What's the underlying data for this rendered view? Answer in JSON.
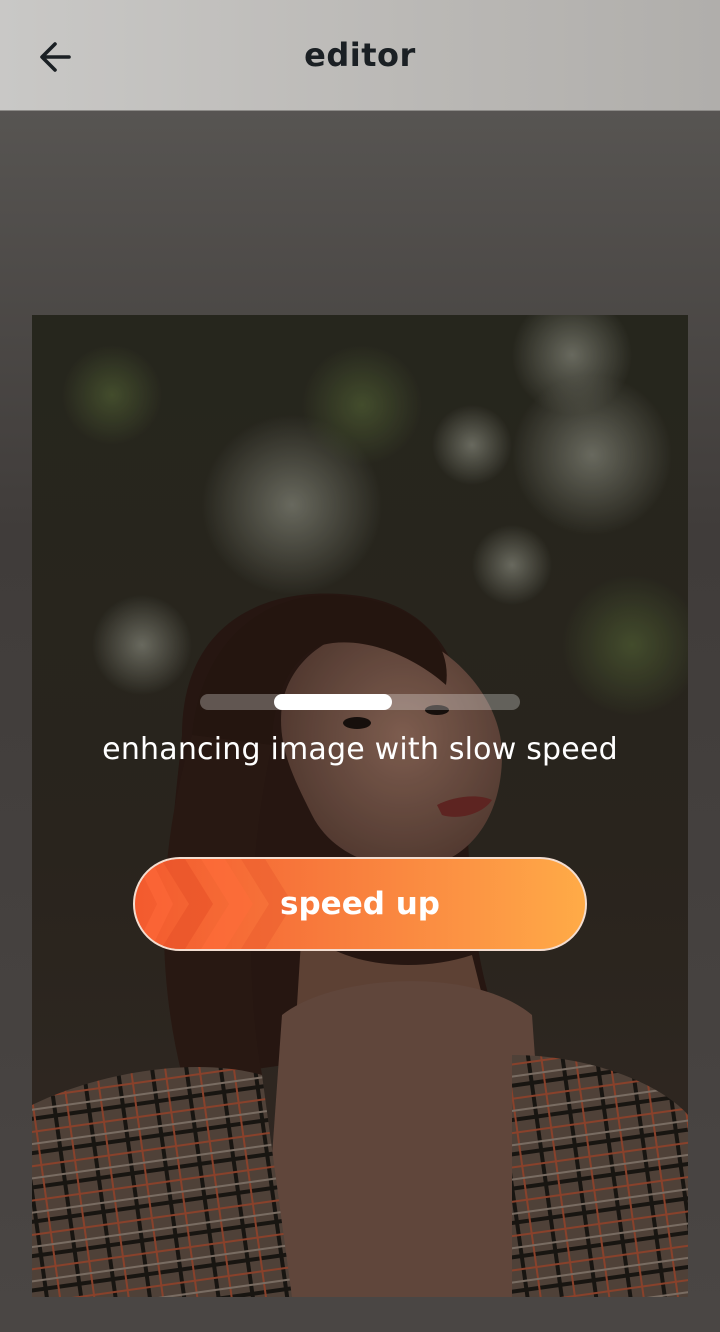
{
  "header": {
    "title": "editor",
    "back_icon": "arrow-left-icon"
  },
  "photo": {
    "subject": "woman-portrait-photo"
  },
  "progress": {
    "fraction_start": 0.23,
    "fraction_end": 0.6
  },
  "status": {
    "text": "enhancing image with slow speed"
  },
  "speed_button": {
    "label": "speed up",
    "icon": "chevrons-right-icon",
    "colors": {
      "start": "#f35a2e",
      "end": "#ffab47"
    }
  }
}
